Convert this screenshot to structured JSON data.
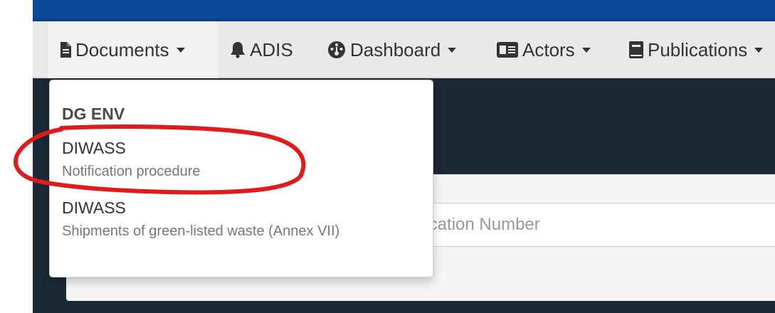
{
  "navbar": {
    "items": [
      {
        "label": "Documents",
        "icon": "document-icon",
        "has_caret": true
      },
      {
        "label": "ADIS",
        "icon": "bell-icon",
        "has_caret": false
      },
      {
        "label": "Dashboard",
        "icon": "dashboard-icon",
        "has_caret": true
      },
      {
        "label": "Actors",
        "icon": "id-card-icon",
        "has_caret": true
      },
      {
        "label": "Publications",
        "icon": "book-icon",
        "has_caret": true
      }
    ]
  },
  "dropdown": {
    "header": "DG ENV",
    "items": [
      {
        "title": "DIWASS",
        "subtitle": "Notification procedure"
      },
      {
        "title": "DIWASS",
        "subtitle": "Shipments of green-listed waste (Annex VII)"
      }
    ]
  },
  "search": {
    "placeholder": "Notification Number"
  },
  "colors": {
    "topbar": "#0d4a9c",
    "navbar": "#e9e9e9",
    "content_bg": "#1b2a36",
    "annotation": "#e01b1b"
  }
}
